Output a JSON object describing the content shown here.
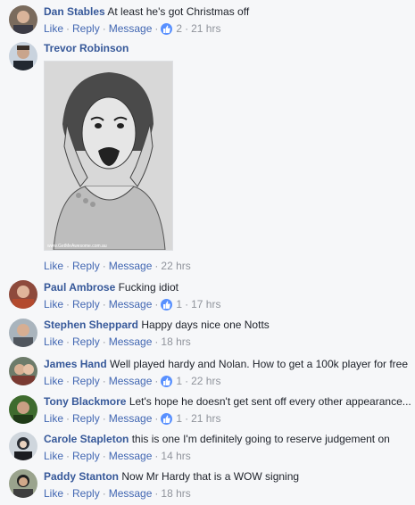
{
  "actions": {
    "like": "Like",
    "reply": "Reply",
    "message": "Message",
    "dot": "·"
  },
  "accent": "#365899",
  "comments": [
    {
      "name": "Dan Stables",
      "text": "At least he's got Christmas off",
      "likes": "2",
      "time": "21 hrs"
    },
    {
      "name": "Trevor Robinson",
      "text": "",
      "likes": "",
      "time": "22 hrs",
      "image_watermark": "www.GetMeAwesome.com.au"
    },
    {
      "name": "Paul Ambrose",
      "text": "Fucking idiot",
      "likes": "1",
      "time": "17 hrs"
    },
    {
      "name": "Stephen Sheppard",
      "text": "Happy days nice one Notts",
      "likes": "",
      "time": "18 hrs"
    },
    {
      "name": "James Hand",
      "text": "Well played hardy and Nolan. How to get a 100k player for free",
      "likes": "1",
      "time": "22 hrs"
    },
    {
      "name": "Tony Blackmore",
      "text": "Let's hope he doesn't get sent off every other appearance...",
      "likes": "1",
      "time": "21 hrs"
    },
    {
      "name": "Carole Stapleton",
      "text": "this is one I'm definitely going to reserve judgement on",
      "likes": "",
      "time": "14 hrs"
    },
    {
      "name": "Paddy Stanton",
      "text": "Now Mr Hardy that is a WOW signing",
      "likes": "",
      "time": "18 hrs"
    }
  ]
}
